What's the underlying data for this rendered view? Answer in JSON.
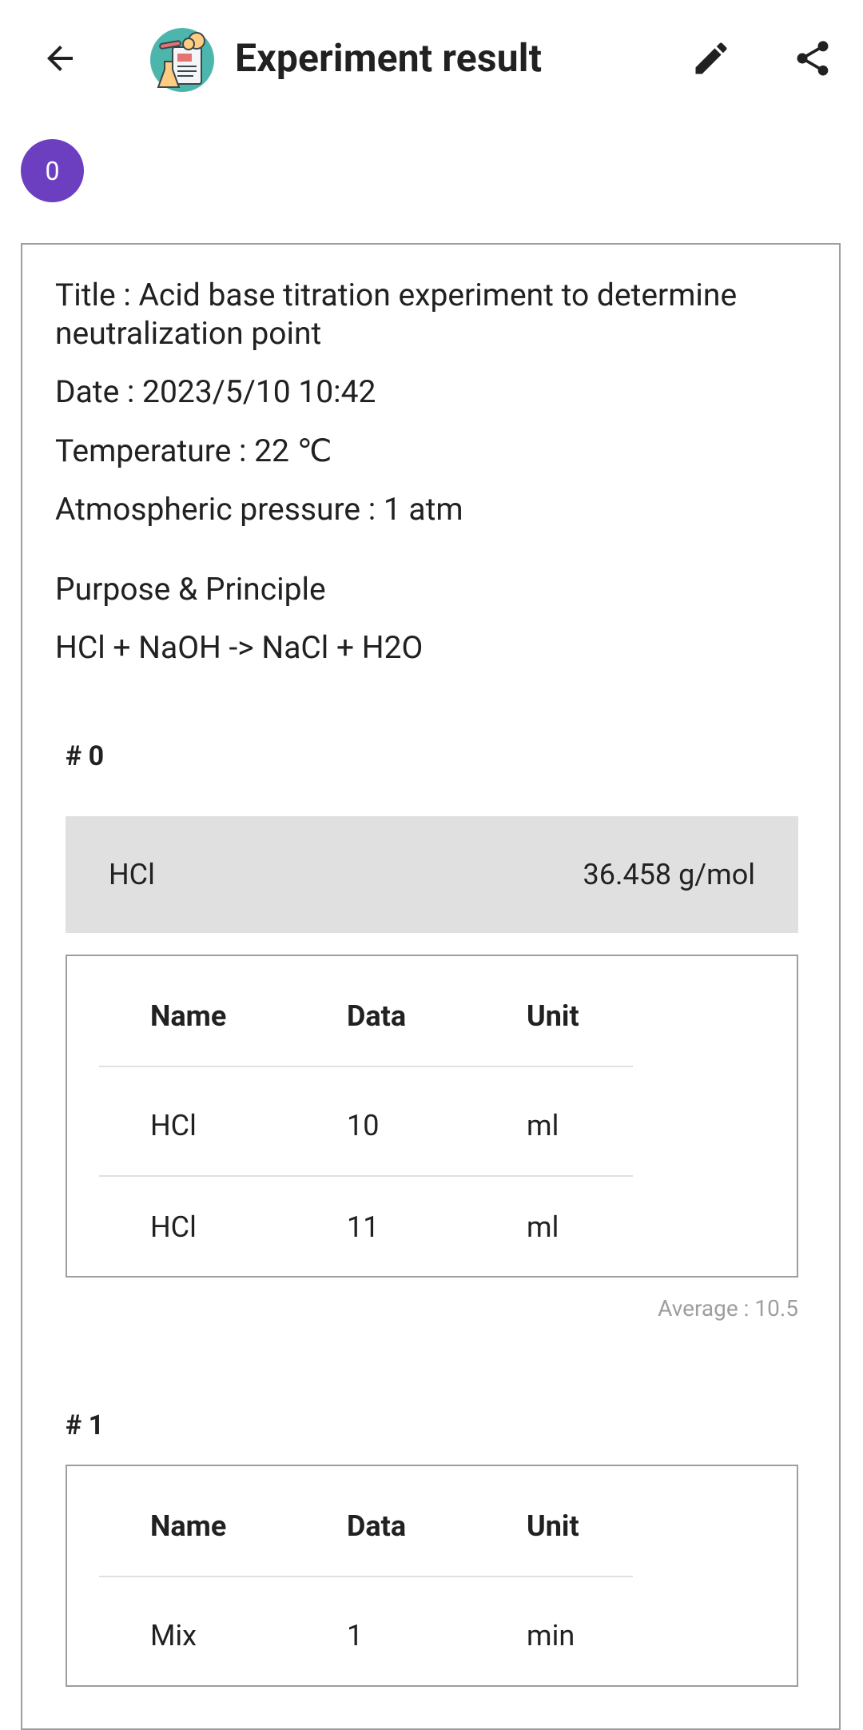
{
  "header": {
    "title": "Experiment result",
    "back_icon": "arrow-back-icon",
    "logo_icon": "lab-experiment-logo-icon",
    "edit_icon": "pencil-edit-icon",
    "share_icon": "share-icon"
  },
  "badge": {
    "value": "0",
    "color": "#6c3fc0"
  },
  "info": {
    "title": "Title : Acid base titration experiment to determine neutralization point",
    "date": "Date : 2023/5/10 10:42",
    "temperature": "Temperature : 22 ℃",
    "pressure": "Atmospheric pressure : 1 atm",
    "purpose_heading": "Purpose & Principle",
    "purpose_body": "HCl + NaOH -> NaCl + H2O"
  },
  "sections": [
    {
      "heading": "# 0",
      "compound": {
        "name": "HCl",
        "molar_mass": "36.458 g/mol"
      },
      "columns": [
        "Name",
        "Data",
        "Unit"
      ],
      "rows": [
        [
          "HCl",
          "10",
          "ml"
        ],
        [
          "HCl",
          "11",
          "ml"
        ]
      ],
      "average": "Average : 10.5"
    },
    {
      "heading": "# 1",
      "columns": [
        "Name",
        "Data",
        "Unit"
      ],
      "rows": [
        [
          "Mix",
          "1",
          "min"
        ]
      ]
    }
  ]
}
